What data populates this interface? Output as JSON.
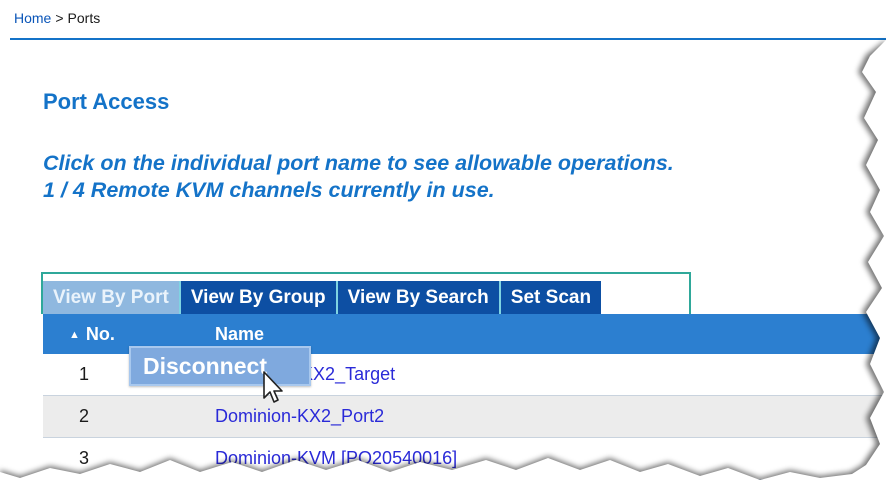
{
  "breadcrumb": {
    "home": "Home",
    "separator": ">",
    "current": "Ports"
  },
  "page": {
    "title": "Port Access",
    "instruction_line1": "Click on the individual port name to see allowable operations.",
    "instruction_line2": "1 / 4 Remote KVM channels currently in use."
  },
  "tabs": [
    {
      "label": "View By Port",
      "active": true
    },
    {
      "label": "View By Group",
      "active": false
    },
    {
      "label": "View By Search",
      "active": false
    },
    {
      "label": "Set Scan",
      "active": false
    }
  ],
  "table": {
    "headers": {
      "sort_icon": "▲",
      "no": "No.",
      "name": "Name"
    },
    "rows": [
      {
        "no": "1",
        "name": "Dominion_KX2_Target"
      },
      {
        "no": "2",
        "name": "Dominion-KX2_Port2"
      },
      {
        "no": "3",
        "name": "Dominion-KVM [PO20540016]"
      }
    ]
  },
  "popup": {
    "label": "Disconnect"
  },
  "colors": {
    "accent": "#1473c8",
    "tab_bg": "#0d4fa3",
    "tab_active_bg": "#8fb8df",
    "header_bg": "#2c7fd0",
    "link": "#2a2ad8"
  }
}
